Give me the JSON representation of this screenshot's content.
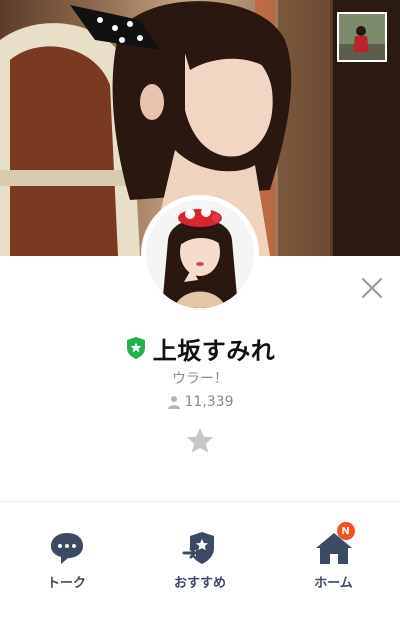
{
  "profile": {
    "name": "上坂すみれ",
    "status_message": "ウラー！",
    "followers": "11,339",
    "verified_color": "#21b24b"
  },
  "icons": {
    "close": "close-icon",
    "favorite": "star-icon",
    "verified": "shield-star-icon",
    "followers": "person-icon"
  },
  "actions": [
    {
      "label": "トーク",
      "icon": "chat-bubble-icon"
    },
    {
      "label": "おすすめ",
      "icon": "share-star-icon"
    },
    {
      "label": "ホーム",
      "icon": "home-icon",
      "badge": "N"
    }
  ],
  "colors": {
    "action_icon": "#3d4a63",
    "badge": "#f4511e",
    "muted_text": "#8a8a8a"
  }
}
